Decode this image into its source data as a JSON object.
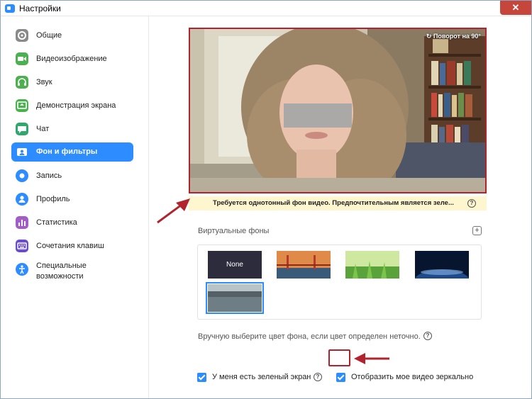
{
  "window": {
    "title": "Настройки",
    "close_glyph": "✕"
  },
  "sidebar": {
    "items": [
      {
        "label": "Общие",
        "icon": "gear-icon",
        "color": "#8a8a8a"
      },
      {
        "label": "Видеоизображение",
        "icon": "video-camera-icon",
        "color": "#4caf50"
      },
      {
        "label": "Звук",
        "icon": "headphones-icon",
        "color": "#4caf50"
      },
      {
        "label": "Демонстрация экрана",
        "icon": "screen-share-icon",
        "color": "#4caf50"
      },
      {
        "label": "Чат",
        "icon": "chat-bubble-icon",
        "color": "#2ea86b"
      },
      {
        "label": "Фон и фильтры",
        "icon": "person-card-icon",
        "color": "#ffffff",
        "active": true
      },
      {
        "label": "Запись",
        "icon": "record-icon",
        "color": "#2d8cff"
      },
      {
        "label": "Профиль",
        "icon": "profile-icon",
        "color": "#2d8cff"
      },
      {
        "label": "Статистика",
        "icon": "statistics-icon",
        "color": "#a35cc8"
      },
      {
        "label": "Сочетания клавиш",
        "icon": "keyboard-icon",
        "color": "#6a4cc8"
      },
      {
        "label": "Специальные возможности",
        "icon": "accessibility-icon",
        "color": "#2d8cff"
      }
    ]
  },
  "preview": {
    "rotate_label": "Поворот на 90°",
    "banner_text": "Требуется однотонный фон видео. Предпочтительным является зеле...",
    "help_glyph": "?"
  },
  "virtual_backgrounds": {
    "label": "Виртуальные фоны",
    "add_glyph": "+",
    "thumbnails": [
      {
        "label": "None"
      }
    ]
  },
  "color_pick": {
    "label": "Вручную выберите цвет фона, если цвет определен неточно.",
    "help_glyph": "?"
  },
  "options": {
    "green_screen_label": "У меня есть зеленый экран",
    "green_screen_checked": true,
    "green_screen_help": "?",
    "mirror_label": "Отобразить мое видео зеркально",
    "mirror_checked": true
  },
  "colors": {
    "accent": "#2d8cff",
    "highlight": "#b3232d",
    "banner": "#fdf6cf"
  }
}
